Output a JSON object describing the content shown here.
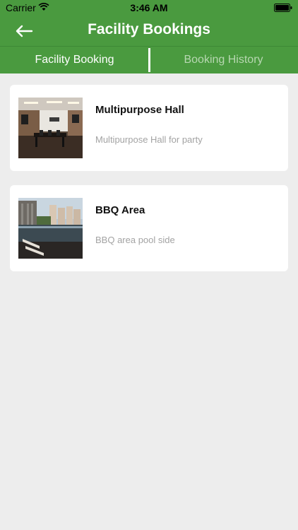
{
  "status_bar": {
    "carrier": "Carrier",
    "time": "3:46 AM",
    "wifi_icon": "wifi-icon",
    "battery_icon": "battery-icon"
  },
  "nav": {
    "title": "Facility Bookings",
    "back_icon": "arrow-left-icon"
  },
  "tabs": [
    {
      "label": "Facility Booking",
      "active": true
    },
    {
      "label": "Booking History",
      "active": false
    }
  ],
  "facilities": [
    {
      "name": "Multipurpose Hall",
      "description": "Multipurpose Hall for party",
      "image": "hall-photo"
    },
    {
      "name": "BBQ Area",
      "description": "BBQ area pool side",
      "image": "pool-photo"
    }
  ],
  "colors": {
    "header_green": "#4a9a3f",
    "background": "#ededed",
    "inactive_tab_text": "#b7d7b1"
  }
}
